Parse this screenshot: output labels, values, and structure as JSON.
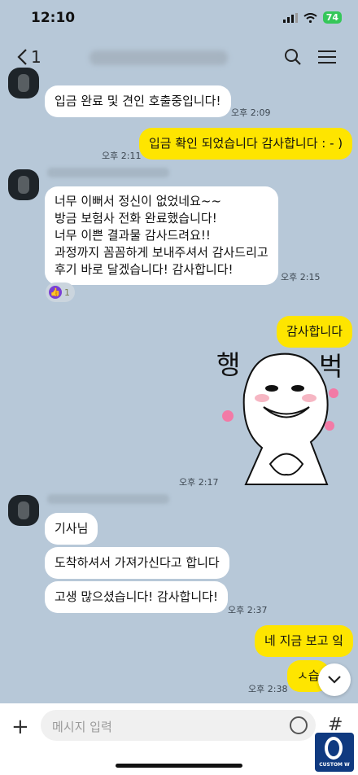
{
  "status": {
    "time": "12:10",
    "battery": "74"
  },
  "header": {
    "back_count": "1"
  },
  "messages": {
    "m1": "입금 완료 및 견인 호출중입니다!",
    "t1": "오후 2:09",
    "m2": "입금 확인 되었습니다 감사합니다 : - )",
    "t2": "오후 2:11",
    "m3": "너무 이뻐서 정신이 없었네요~~\n방금 보험사 전화 완료했습니다!\n너무 이쁜 결과물 감사드려요!!\n과정까지 꼼꼼하게 보내주셔서 감사드리고\n후기 바로 달겠습니다! 감사합니다!",
    "t3": "오후 2:15",
    "reaction_count": "1",
    "m4": "감사합니다",
    "sticker_left": "행",
    "sticker_right": "벅",
    "t4": "오후 2:17",
    "m5": "기사님",
    "m6": "도착하셔서 가져가신다고 합니다",
    "m7": "고생 많으셨습니다! 감사합니다!",
    "t5": "오후 2:37",
    "m8": "네 지금 보고 잌",
    "m9": "ㅅ습",
    "t6": "오후 2:38"
  },
  "input": {
    "placeholder": "메시지 입력"
  },
  "logo": {
    "text": "CUSTOM W"
  }
}
